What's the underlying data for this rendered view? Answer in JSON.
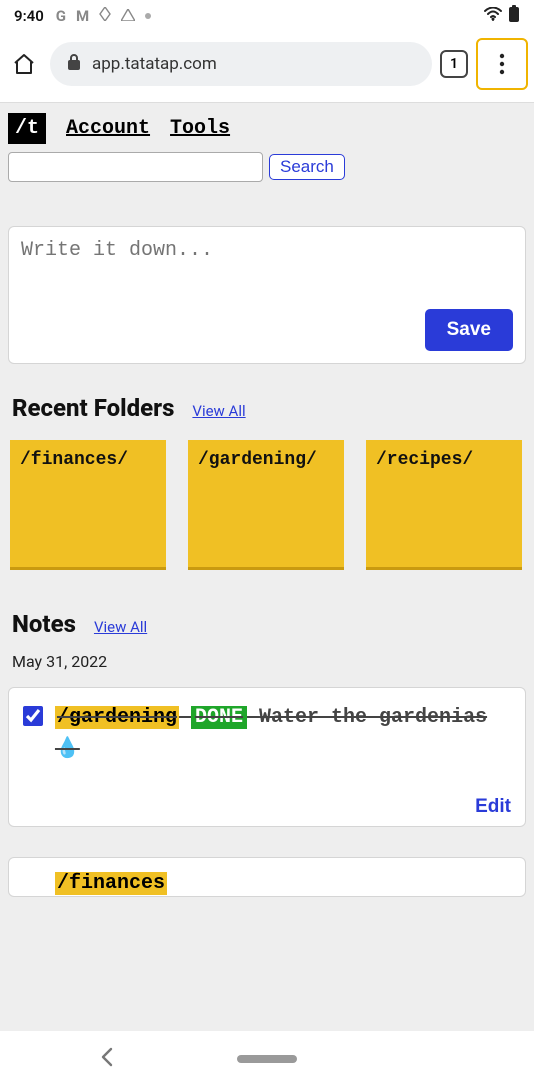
{
  "status": {
    "time": "9:40",
    "app_icons": [
      "G",
      "M",
      "◈",
      "▲"
    ]
  },
  "browser": {
    "url": "app.tatatap.com",
    "tab_count": "1"
  },
  "nav": {
    "logo": "/t",
    "account": "Account",
    "tools": "Tools"
  },
  "search": {
    "placeholder": "",
    "button": "Search"
  },
  "compose": {
    "placeholder": "Write it down...",
    "save": "Save"
  },
  "recent_folders": {
    "title": "Recent Folders",
    "view_all": "View All",
    "items": [
      {
        "name": "/finances/"
      },
      {
        "name": "/gardening/"
      },
      {
        "name": "/recipes/"
      }
    ]
  },
  "notes": {
    "title": "Notes",
    "view_all": "View All",
    "date": "May 31, 2022",
    "items": [
      {
        "checked": true,
        "folder_tag": "/gardening",
        "status_tag": "DONE",
        "text": " Water the gardenias💧",
        "edit": "Edit"
      },
      {
        "folder_tag": "/finances"
      }
    ]
  }
}
